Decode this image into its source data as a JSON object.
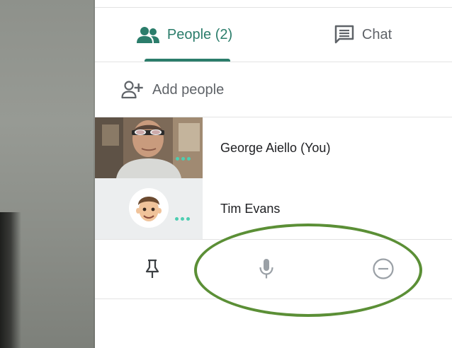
{
  "tabs": {
    "people_label": "People (2)",
    "chat_label": "Chat"
  },
  "add_people": {
    "label": "Add people"
  },
  "participants": [
    {
      "name": "George Aiello (You)",
      "menu_icon": "more-dots-icon"
    },
    {
      "name": "Tim Evans",
      "menu_icon": "more-dots-icon"
    }
  ],
  "controls": {
    "icons": [
      "pin-icon",
      "microphone-icon",
      "remove-icon"
    ]
  },
  "colors": {
    "accent": "#2b7d6b",
    "dots": "#4ecdb1",
    "annotation": "#5b8f36",
    "icon_gray": "#5f6368"
  }
}
